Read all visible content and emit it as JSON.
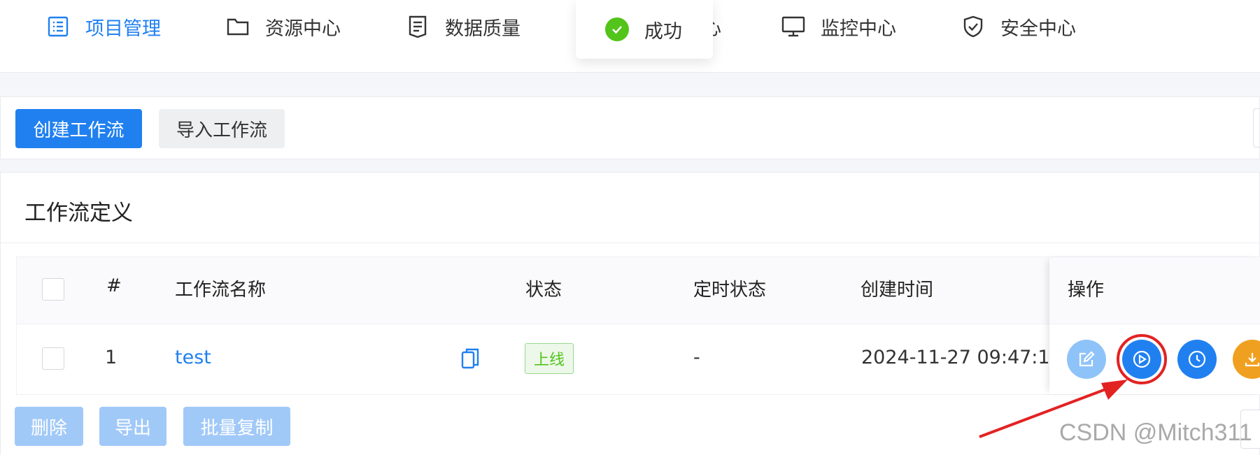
{
  "nav": {
    "items": [
      {
        "label": "项目管理",
        "icon": "list-icon",
        "active": true
      },
      {
        "label": "资源中心",
        "icon": "folder-icon"
      },
      {
        "label": "数据质量",
        "icon": "document-icon"
      },
      {
        "label": "心",
        "icon": ""
      },
      {
        "label": "监控中心",
        "icon": "monitor-icon"
      },
      {
        "label": "安全中心",
        "icon": "shield-icon"
      }
    ]
  },
  "toast": {
    "message": "成功",
    "icon": "check-circle-icon"
  },
  "toolbar": {
    "create_label": "创建工作流",
    "import_label": "导入工作流"
  },
  "card": {
    "title": "工作流定义"
  },
  "table": {
    "columns": [
      "#",
      "工作流名称",
      "状态",
      "定时状态",
      "创建时间",
      "操作"
    ],
    "rows": [
      {
        "index": "1",
        "name": "test",
        "status": "上线",
        "schedule_status": "-",
        "created": "2024-11-27 09:47:1"
      }
    ],
    "operations": [
      "edit-icon",
      "run-icon",
      "timer-icon",
      "download-icon"
    ]
  },
  "batch": {
    "delete_label": "删除",
    "export_label": "导出",
    "copy_label": "批量复制"
  },
  "watermark": "CSDN @Mitch311",
  "colors": {
    "primary": "#2080f0",
    "success": "#52c41a",
    "warning": "#f0a020",
    "annotation": "#e32222"
  }
}
